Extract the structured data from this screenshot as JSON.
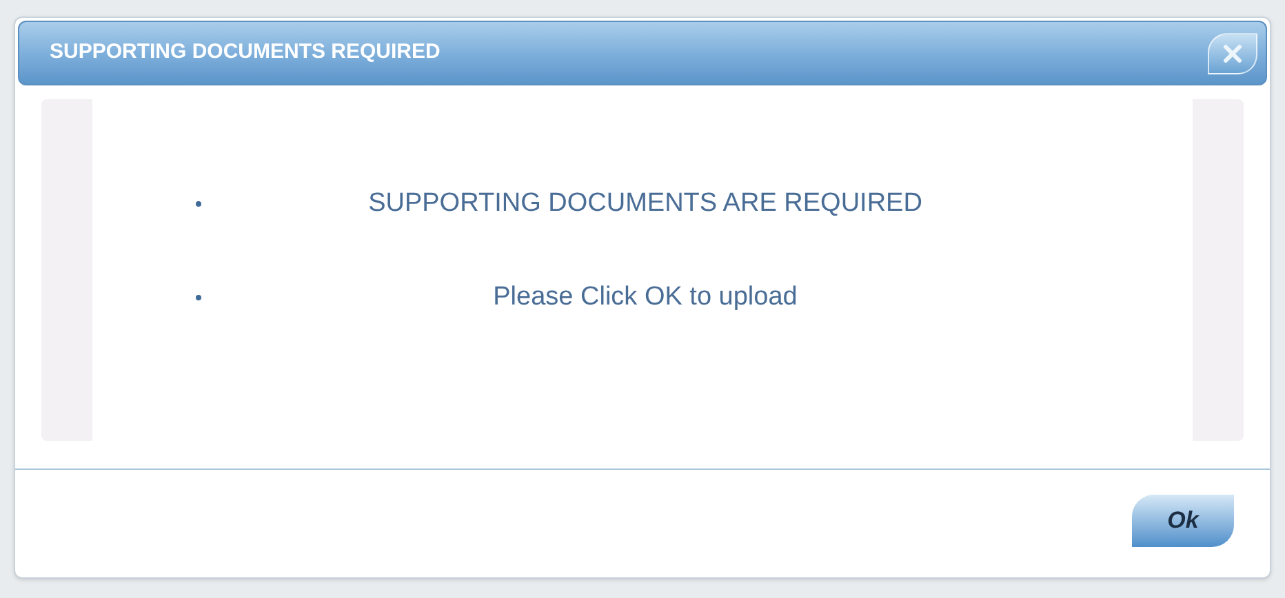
{
  "dialog": {
    "title": "SUPPORTING DOCUMENTS REQUIRED",
    "messages": [
      "SUPPORTING DOCUMENTS ARE REQUIRED",
      "Please Click OK to upload"
    ],
    "buttons": [
      "Ok"
    ]
  }
}
